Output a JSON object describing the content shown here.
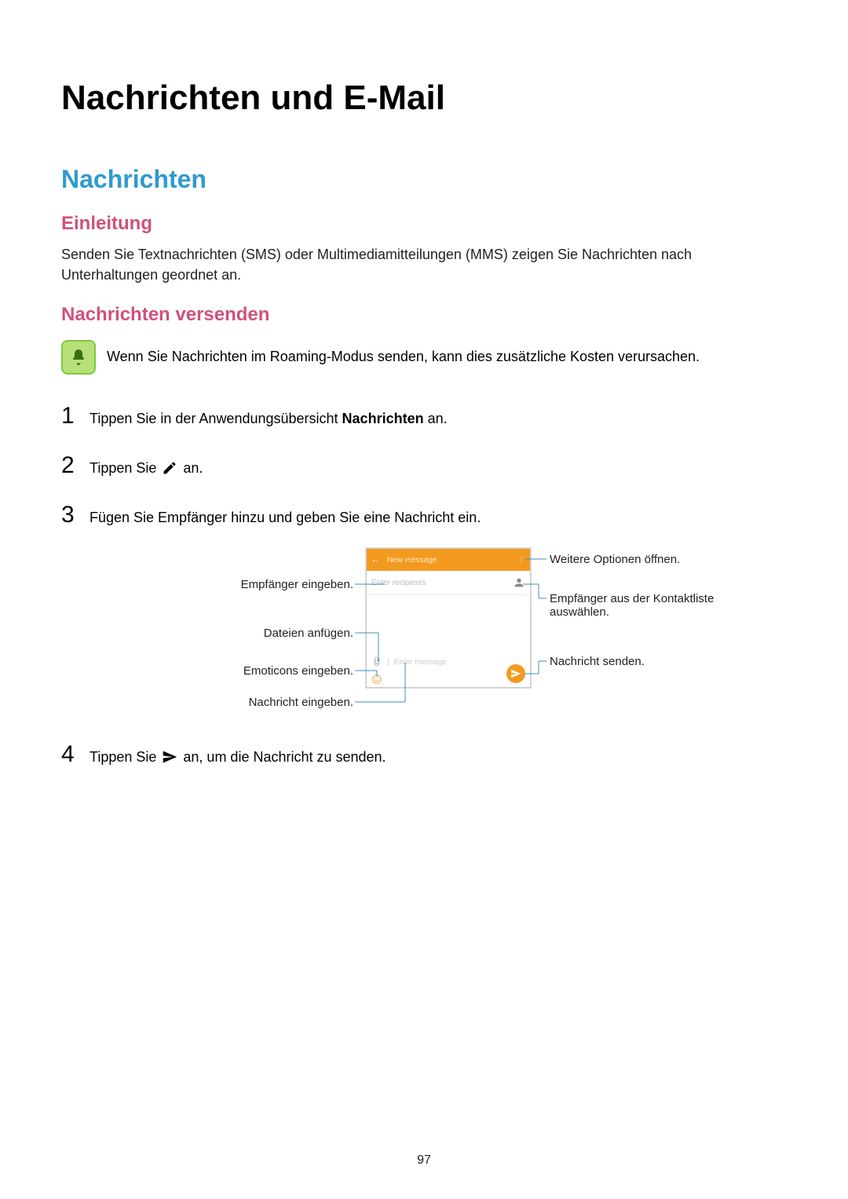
{
  "page_number": "97",
  "chapter_title": "Nachrichten und E-Mail",
  "section_title": "Nachrichten",
  "intro_heading": "Einleitung",
  "intro_body": "Senden Sie Textnachrichten (SMS) oder Multimediamitteilungen (MMS) zeigen Sie Nachrichten nach Unterhaltungen geordnet an.",
  "send_heading": "Nachrichten versenden",
  "roaming_note": "Wenn Sie Nachrichten im Roaming-Modus senden, kann dies zusätzliche Kosten verursachen.",
  "steps": [
    {
      "n": "1",
      "pre": "Tippen Sie in der Anwendungsübersicht ",
      "bold": "Nachrichten",
      "post": " an."
    },
    {
      "n": "2",
      "pre": "Tippen Sie ",
      "icon": "compose",
      "post": " an."
    },
    {
      "n": "3",
      "pre": "Fügen Sie Empfänger hinzu und geben Sie eine Nachricht ein.",
      "bold": "",
      "post": ""
    },
    {
      "n": "4",
      "pre": "Tippen Sie ",
      "icon": "send",
      "post": " an, um die Nachricht zu senden."
    }
  ],
  "diagram": {
    "appbar_title": "New message",
    "recipients_placeholder": "Enter recipients",
    "compose_placeholder": "Enter message",
    "labels_left": {
      "recipients": "Empfänger eingeben.",
      "attach": "Dateien anfügen.",
      "emoticons": "Emoticons eingeben.",
      "message": "Nachricht eingeben."
    },
    "labels_right": {
      "more": "Weitere Optionen öffnen.",
      "contacts": "Empfänger aus der Kontaktliste auswählen.",
      "send": "Nachricht senden."
    }
  }
}
